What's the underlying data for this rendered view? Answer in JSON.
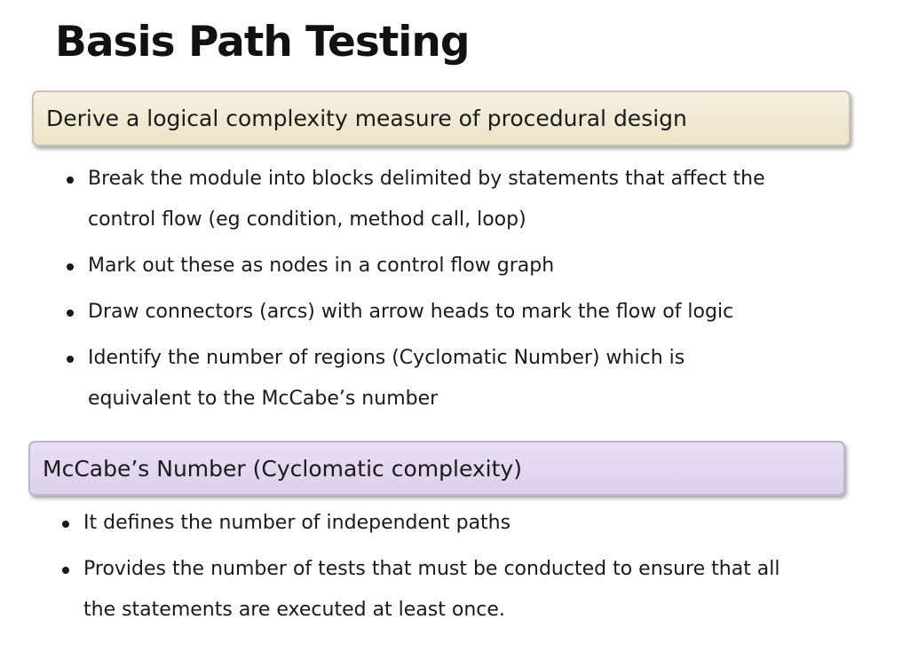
{
  "slide": {
    "title": "Basis Path Testing",
    "sections": [
      {
        "heading": "Derive a logical complexity measure of procedural design",
        "bullets": [
          {
            "lines": [
              "Break the module into blocks delimited by statements that affect the",
              "control flow (eg condition, method call, loop)"
            ]
          },
          {
            "lines": [
              "Mark out these as nodes in a control flow graph"
            ]
          },
          {
            "lines": [
              "Draw connectors (arcs) with arrow heads to mark the flow of logic"
            ]
          },
          {
            "lines": [
              "Identify the number of regions (Cyclomatic Number) which is",
              "equivalent to the McCabe’s number"
            ]
          }
        ],
        "color": "#ece3c8"
      },
      {
        "heading": "McCabe’s Number (Cyclomatic complexity)",
        "bullets": [
          {
            "lines": [
              "It defines the number of independent paths"
            ]
          },
          {
            "lines": [
              "Provides the number of tests that must be conducted to ensure that all",
              "the statements are executed at least once."
            ]
          }
        ],
        "color": "#dcd0ec"
      }
    ]
  }
}
